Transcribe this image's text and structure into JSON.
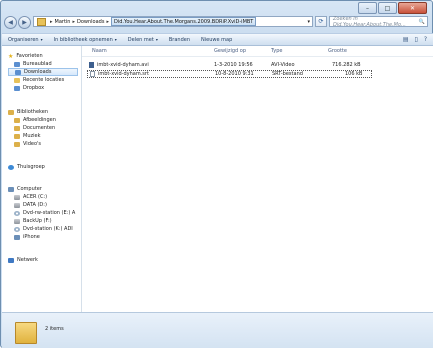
{
  "window": {
    "minimize": "–",
    "maximize": "□",
    "close": "✕"
  },
  "nav": {
    "back": "◀",
    "forward": "▶",
    "dropdown": "▾"
  },
  "address": {
    "crumbs": [
      "Martin",
      "Downloads",
      "Did.You.Hear.About.The.Morgans.2009.BDRiP.XviD-iMBT"
    ],
    "separator": "▸",
    "dropdown_arrow": "▾",
    "refresh": "⟳"
  },
  "search": {
    "placeholder": "Zoeken in Did.You.Hear.About.The.Mo...",
    "icon": "🔍"
  },
  "toolbar": {
    "organize": "Organiseren",
    "include_library": "In bibliotheek opnemen",
    "share": "Delen met",
    "burn": "Branden",
    "new_folder": "Nieuwe map",
    "arrow": "▾",
    "view_icon": "▤",
    "preview_icon": "▯",
    "help_icon": "?"
  },
  "sidebar": {
    "favorites": "Favorieten",
    "favorites_items": [
      "Bureaublad",
      "Downloads",
      "Recente locaties",
      "Dropbox"
    ],
    "libraries": "Bibliotheken",
    "libraries_items": [
      "Afbeeldingen",
      "Documenten",
      "Muziek",
      "Video's"
    ],
    "homegroup": "Thuisgroep",
    "computer": "Computer",
    "computer_items": [
      "ACER (C:)",
      "DATA (D:)",
      "Dvd-rw-station (E:) A",
      "BackUp (F:)",
      "Dvd-station (K:) ADI",
      "iPhone"
    ],
    "network": "Netwerk"
  },
  "columns": {
    "name": "Naam",
    "modified": "Gewijzigd op",
    "type": "Type",
    "size": "Grootte"
  },
  "files": [
    {
      "name": "imbt-xvid-dyham.avi",
      "modified": "1-3-2010 19:56",
      "type": "AVI-Video",
      "size": "716.282 kB"
    },
    {
      "name": "imbt-xvid-dyham.srt",
      "modified": "10-8-2010 9:31",
      "type": "SRT-bestand",
      "size": "106 kB"
    }
  ],
  "status": {
    "count": "2 items"
  }
}
